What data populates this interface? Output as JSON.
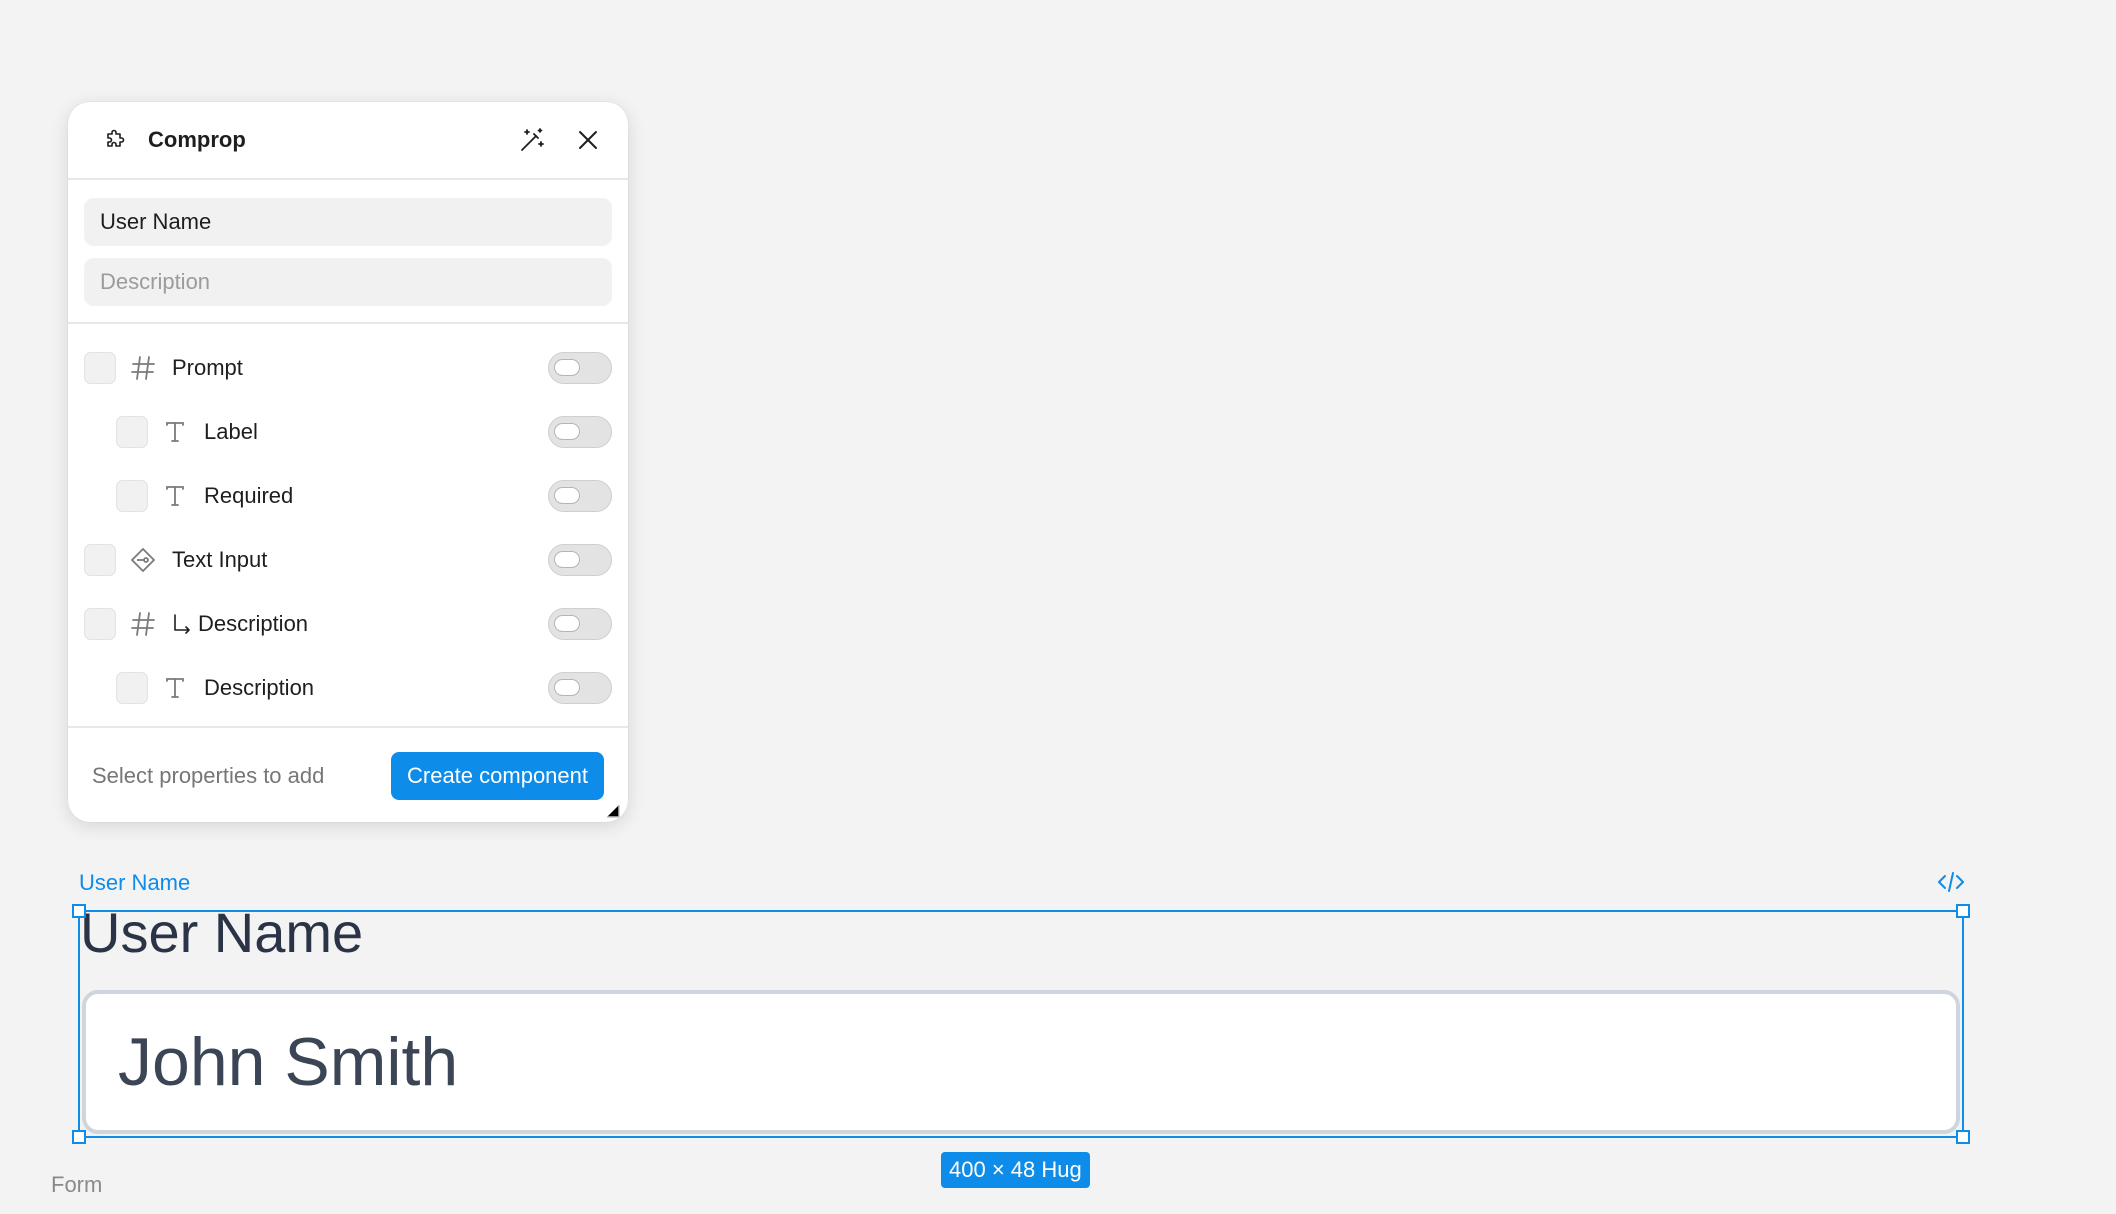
{
  "panel": {
    "title": "Comprop",
    "name_value": "User Name",
    "description_placeholder": "Description",
    "properties": [
      {
        "label": "Prompt",
        "icon": "hash-icon",
        "child": false,
        "enabled": false
      },
      {
        "label": "Label",
        "icon": "text-icon",
        "child": true,
        "enabled": false
      },
      {
        "label": "Required",
        "icon": "text-icon",
        "child": true,
        "enabled": false
      },
      {
        "label": "Text Input",
        "icon": "instance-icon",
        "child": false,
        "enabled": false
      },
      {
        "label": "Description",
        "icon": "hash-icon",
        "child": false,
        "enabled": false,
        "nested_arrow": true
      },
      {
        "label": "Description",
        "icon": "text-icon",
        "child": true,
        "enabled": false
      }
    ],
    "footer_hint": "Select properties to add",
    "create_label": "Create component"
  },
  "canvas": {
    "selection_name": "User Name",
    "component_label": "User Name",
    "component_value": "John Smith",
    "size_badge": "400 × 48 Hug",
    "frame_name": "Form"
  },
  "colors": {
    "accent": "#0d8ce9",
    "background": "#f3f3f3"
  }
}
